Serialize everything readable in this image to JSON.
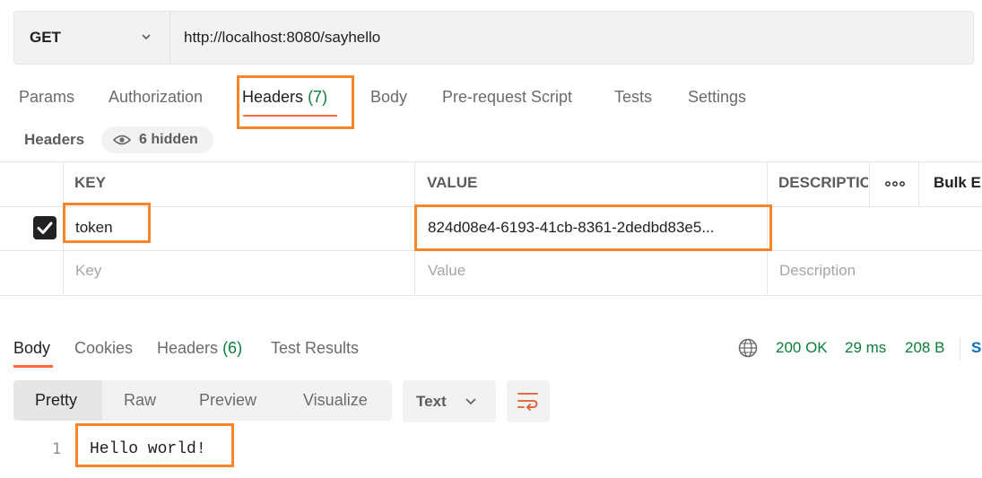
{
  "request": {
    "method": "GET",
    "url": "http://localhost:8080/sayhello"
  },
  "request_tabs": [
    {
      "label": "Params"
    },
    {
      "label": "Authorization"
    },
    {
      "label": "Headers",
      "count": "(7)"
    },
    {
      "label": "Body"
    },
    {
      "label": "Pre-request Script"
    },
    {
      "label": "Tests"
    },
    {
      "label": "Settings"
    }
  ],
  "headers_section": {
    "title": "Headers",
    "hidden_label": "6 hidden"
  },
  "table": {
    "columns": [
      "KEY",
      "VALUE",
      "DESCRIPTIC"
    ],
    "bulk_edit": "Bulk E",
    "rows": [
      {
        "checked": true,
        "key": "token",
        "value": "824d08e4-6193-41cb-8361-2dedbd83e5..."
      }
    ],
    "placeholders": {
      "key": "Key",
      "value": "Value",
      "description": "Description"
    }
  },
  "response_tabs": [
    {
      "label": "Body"
    },
    {
      "label": "Cookies"
    },
    {
      "label": "Headers",
      "count": "(6)"
    },
    {
      "label": "Test Results"
    }
  ],
  "response_status": {
    "status": "200 OK",
    "time": "29 ms",
    "size": "208 B",
    "save_edge": "S"
  },
  "view_modes": [
    "Pretty",
    "Raw",
    "Preview",
    "Visualize"
  ],
  "format": "Text",
  "body": {
    "line_number": "1",
    "content": "Hello world!"
  },
  "colors": {
    "accent": "#ff6c37",
    "highlight_box": "#f7852b",
    "status_green": "#0a7e3a"
  },
  "icons": [
    "chevron-down-icon",
    "eye-icon",
    "checkmark-icon",
    "more-horizontal-icon",
    "globe-icon",
    "wrap-lines-icon"
  ]
}
